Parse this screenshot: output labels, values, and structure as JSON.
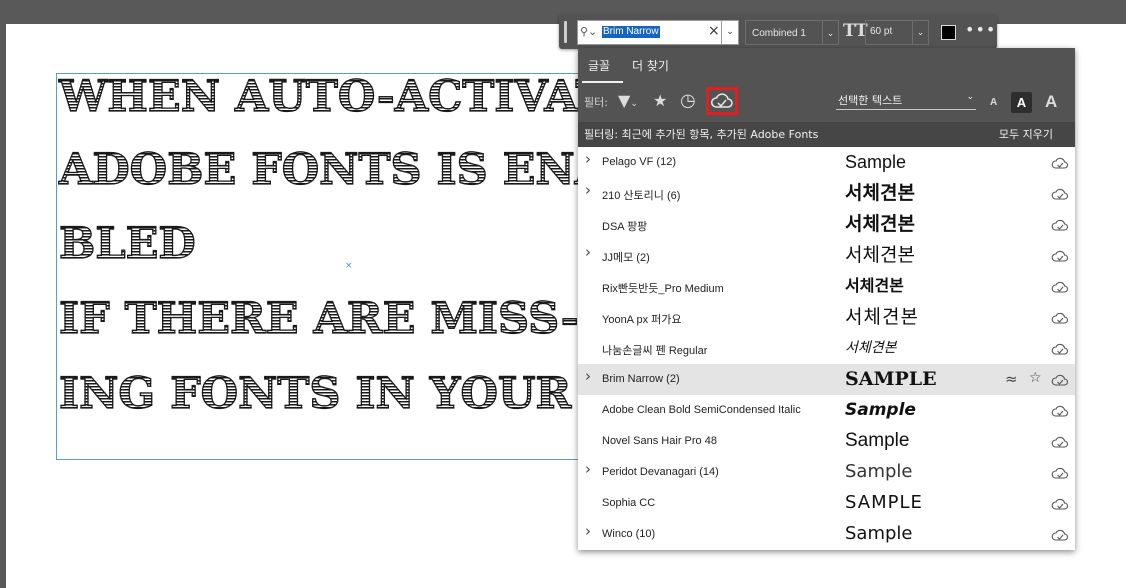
{
  "document": {
    "lines": [
      "WHEN AUTO-ACTIVAT",
      "ADOBE FONTS IS ENA-",
      "BLED",
      "IF THERE ARE MISS-",
      "ING FONTS IN YOUR"
    ],
    "center_marker": "×"
  },
  "toolbar": {
    "font_search_value": "Brim Narrow",
    "clear_glyph": "×",
    "dropdown_glyph": "⌄",
    "style": "Combined 1",
    "size_icon": "TT",
    "size": "60 pt",
    "color": "#000000",
    "more_glyph": "•••"
  },
  "panel": {
    "tabs": [
      {
        "label": "글꼴",
        "active": true
      },
      {
        "label": "더 찾기",
        "active": false
      }
    ],
    "filter_label": "필터:",
    "preview_text_select": "선택한 텍스트",
    "size_labels": [
      "A",
      "A",
      "A"
    ],
    "filter_applied": "필터링: 최근에 추가된 항목, 추가된 Adobe Fonts",
    "clear_all": "모두 지우기",
    "highlight_color": "#e02020",
    "fonts": [
      {
        "name": "Pelago VF (12)",
        "sample": "Sample",
        "has_children": true,
        "selected": false
      },
      {
        "name": "210 산토리니 (6)",
        "sample": "서체견본",
        "has_children": true,
        "selected": false
      },
      {
        "name": "DSA 팡팡",
        "sample": "서체견본",
        "has_children": false,
        "selected": false
      },
      {
        "name": "JJ메모 (2)",
        "sample": "서체견본",
        "has_children": true,
        "selected": false
      },
      {
        "name": "Rix빤듯반듯_Pro Medium",
        "sample": "서체견본",
        "has_children": false,
        "selected": false
      },
      {
        "name": "YoonA px 퍼가요",
        "sample": "서체견본",
        "has_children": false,
        "selected": false
      },
      {
        "name": "나눔손글씨 펜 Regular",
        "sample": "서체견본",
        "has_children": false,
        "selected": false
      },
      {
        "name": "Brim Narrow (2)",
        "sample": "SAMPLE",
        "has_children": true,
        "selected": true
      },
      {
        "name": "Adobe Clean Bold SemiCondensed Italic",
        "sample": "Sample",
        "has_children": false,
        "selected": false
      },
      {
        "name": "Novel Sans Hair Pro 48",
        "sample": "Sample",
        "has_children": false,
        "selected": false
      },
      {
        "name": "Peridot Devanagari (14)",
        "sample": "Sample",
        "has_children": true,
        "selected": false
      },
      {
        "name": "Sophia CC",
        "sample": "SAMPLE",
        "has_children": false,
        "selected": false
      },
      {
        "name": "Winco (10)",
        "sample": "Sample",
        "has_children": true,
        "selected": false
      }
    ],
    "row_icons": {
      "similar": "≈",
      "favorite": "☆"
    }
  }
}
